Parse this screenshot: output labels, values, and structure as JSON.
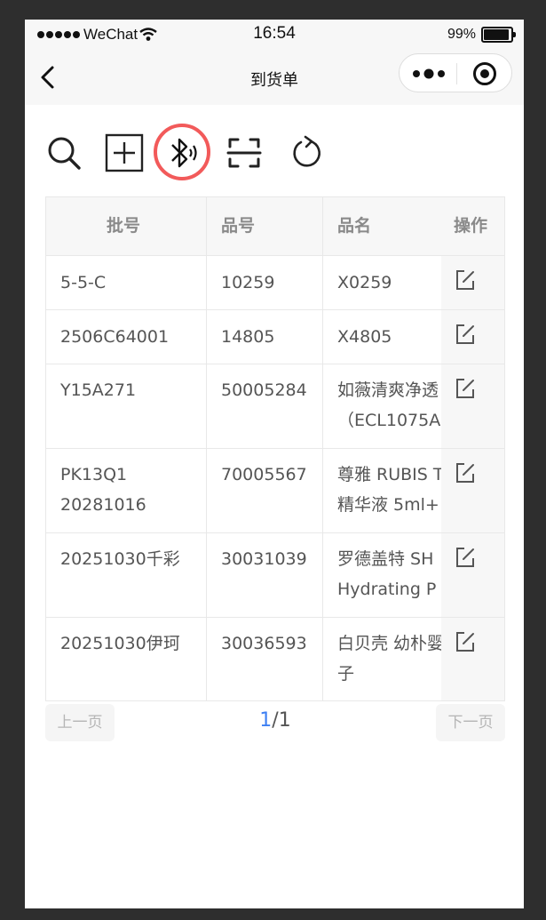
{
  "status_bar": {
    "carrier": "WeChat",
    "time": "16:54",
    "battery": "99%"
  },
  "nav": {
    "title": "到货单",
    "back_icon": "chevron-left-icon",
    "more_icon": "more-dots-icon",
    "close_icon": "target-circle-icon"
  },
  "toolbar": {
    "items": [
      {
        "name": "search",
        "icon": "search-icon"
      },
      {
        "name": "add",
        "icon": "plus-box-icon"
      },
      {
        "name": "bluetooth",
        "icon": "bluetooth-icon",
        "highlighted": true
      },
      {
        "name": "scan",
        "icon": "scan-icon"
      },
      {
        "name": "refresh",
        "icon": "refresh-icon"
      }
    ],
    "highlight_color": "#f25a5a"
  },
  "table": {
    "headers": [
      "批号",
      "品号",
      "品名",
      "操作"
    ],
    "rows": [
      {
        "batch": "5-5-C",
        "code": "10259",
        "name": [
          "X0259"
        ]
      },
      {
        "batch": "2506C64001",
        "code": "14805",
        "name": [
          "X4805"
        ]
      },
      {
        "batch": "Y15A271",
        "code": "50005284",
        "name": [
          "如薇清爽净透",
          "（ECL1075A"
        ]
      },
      {
        "batch": [
          "PK13Q1",
          "20281016"
        ],
        "code": "70005567",
        "name": [
          "尊雅 RUBIS T",
          "精华液 5ml+"
        ]
      },
      {
        "batch": "20251030千彩",
        "code": "30031039",
        "name": [
          "罗德盖特 SH",
          "Hydrating P"
        ]
      },
      {
        "batch": "20251030伊珂",
        "code": "30036593",
        "name": [
          "白贝壳 幼朴婴",
          "子"
        ]
      }
    ]
  },
  "pager": {
    "prev_label": "上一页",
    "next_label": "下一页",
    "current": "1",
    "separator": "/",
    "total": "1",
    "current_color": "#3d7ff3"
  }
}
